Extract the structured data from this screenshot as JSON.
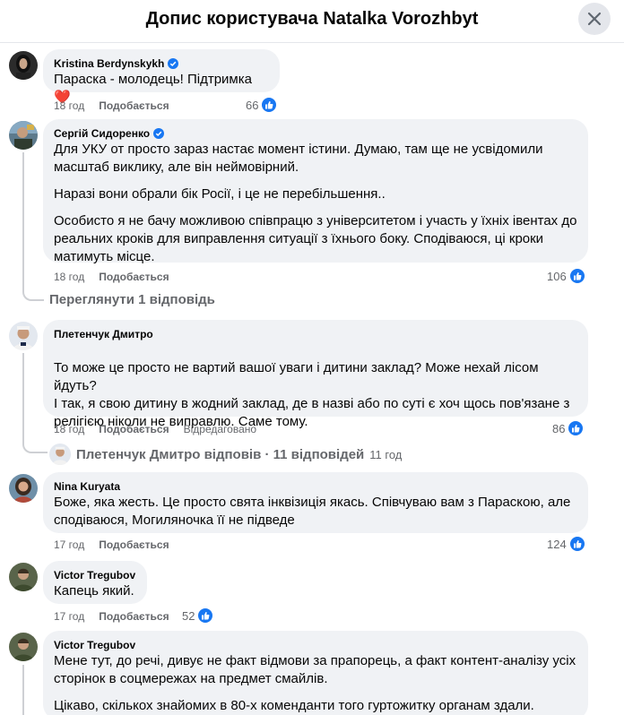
{
  "header": {
    "title": "Допис користувача Natalka Vorozhbyt"
  },
  "comments": [
    {
      "author": "Kristina Berdynskykh",
      "verified": true,
      "text": [
        "Параска - молодець! Підтримка ❤️"
      ],
      "time": "18 год",
      "like_label": "Подобається",
      "reactions": "66"
    },
    {
      "author": "Сергій Сидоренко",
      "verified": true,
      "text": [
        "Для УКУ от просто зараз настає момент істини. Думаю, там ще не усвідомили масштаб виклику, але він неймовірний.",
        "Наразі вони обрали бік Росії, і це не перебільшення..",
        "Особисто я не бачу можливою співпрацю з університетом і участь у їхніх івентах до реальних кроків для виправлення ситуації з їхнього боку. Сподіваюся, ці кроки матимуть місце."
      ],
      "time": "18 год",
      "like_label": "Подобається",
      "reactions": "106",
      "view_replies": "Переглянути 1 відповідь"
    },
    {
      "author": "Плетенчук Дмитро",
      "verified": false,
      "text": [
        "То може це просто не вартий вашої уваги і дитини заклад? Може нехай лісом йдуть?\nІ так, я свою дитину в жодний заклад, де в назві або по суті є хоч щось пов'язане з релігією ніколи не виправлю. Саме тому."
      ],
      "time": "18 год",
      "like_label": "Подобається",
      "edited": "Відредаговано",
      "reactions": "86",
      "replies_summary": "Плетенчук Дмитро відповів · 11 відповідей",
      "replies_time": "11 год"
    },
    {
      "author": "Nina Kuryata",
      "verified": false,
      "text": [
        "Боже, яка жесть. Це просто свята інквізиція якась. Співчуваю вам з Параскою, але сподіваюся, Могиляночка її не підведе"
      ],
      "time": "17 год",
      "like_label": "Подобається",
      "reactions": "124"
    },
    {
      "author": "Victor Tregubov",
      "verified": false,
      "text": [
        "Капець який."
      ],
      "time": "17 год",
      "like_label": "Подобається",
      "reactions": "52"
    },
    {
      "author": "Victor Tregubov",
      "verified": false,
      "text": [
        "Мене тут, до речі, дивує не факт відмови за прапорець, а факт контент-аналізу усіх сторінок в соцмережах на предмет смайлів.",
        "Цікаво, скількох знайомих в 80-х коменданти того гуртожитку органам здали."
      ]
    }
  ],
  "colors": {
    "bubble": "#f0f2f5",
    "meta": "#65676b",
    "like_blue": "#1877f2",
    "heart": "#e41e3f"
  },
  "icons": {
    "close": "close-icon",
    "verified": "verified-badge-icon",
    "like": "like-icon",
    "heart": "heart-emoji"
  }
}
